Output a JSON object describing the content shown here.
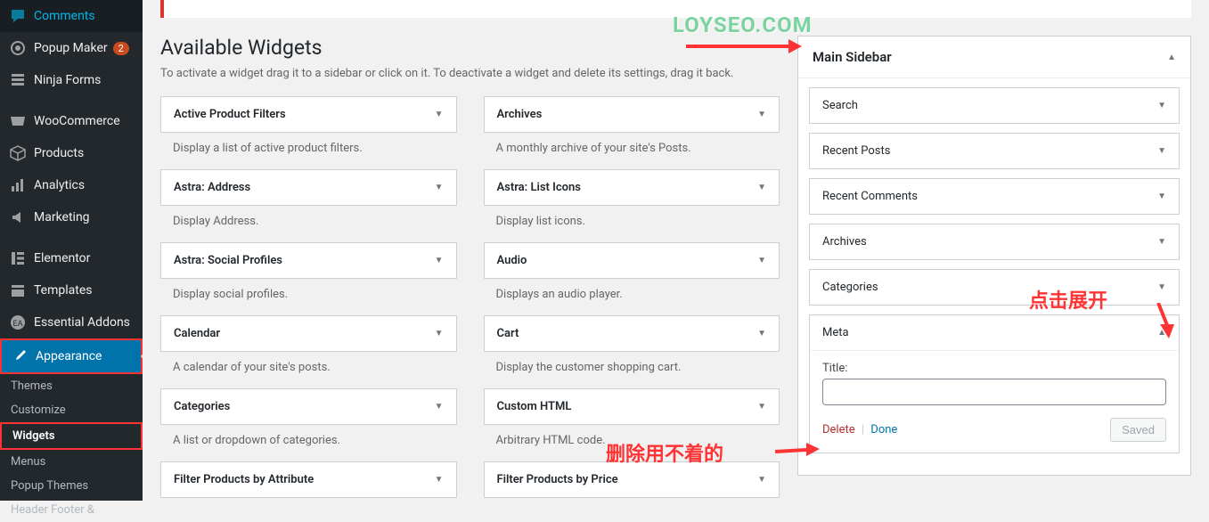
{
  "watermark": "LOYSEO.COM",
  "sidebar": {
    "items": [
      {
        "label": "Comments",
        "icon": "comment"
      },
      {
        "label": "Popup Maker",
        "icon": "popup",
        "badge": "2"
      },
      {
        "label": "Ninja Forms",
        "icon": "form"
      },
      {
        "label": "WooCommerce",
        "icon": "woo"
      },
      {
        "label": "Products",
        "icon": "product"
      },
      {
        "label": "Analytics",
        "icon": "analytics"
      },
      {
        "label": "Marketing",
        "icon": "marketing"
      },
      {
        "label": "Elementor",
        "icon": "elementor"
      },
      {
        "label": "Templates",
        "icon": "templates"
      },
      {
        "label": "Essential Addons",
        "icon": "addons"
      },
      {
        "label": "Appearance",
        "icon": "appearance",
        "active": true
      }
    ],
    "submenu": [
      {
        "label": "Themes"
      },
      {
        "label": "Customize"
      },
      {
        "label": "Widgets",
        "current": true
      },
      {
        "label": "Menus"
      },
      {
        "label": "Popup Themes"
      },
      {
        "label": "Header Footer &"
      }
    ]
  },
  "available": {
    "title": "Available Widgets",
    "desc": "To activate a widget drag it to a sidebar or click on it. To deactivate a widget and delete its settings, drag it back.",
    "widgets": [
      {
        "name": "Active Product Filters",
        "desc": "Display a list of active product filters."
      },
      {
        "name": "Archives",
        "desc": "A monthly archive of your site's Posts."
      },
      {
        "name": "Astra: Address",
        "desc": "Display Address."
      },
      {
        "name": "Astra: List Icons",
        "desc": "Display list icons."
      },
      {
        "name": "Astra: Social Profiles",
        "desc": "Display social profiles."
      },
      {
        "name": "Audio",
        "desc": "Displays an audio player."
      },
      {
        "name": "Calendar",
        "desc": "A calendar of your site's posts."
      },
      {
        "name": "Cart",
        "desc": "Display the customer shopping cart."
      },
      {
        "name": "Categories",
        "desc": "A list or dropdown of categories."
      },
      {
        "name": "Custom HTML",
        "desc": "Arbitrary HTML code."
      },
      {
        "name": "Filter Products by Attribute",
        "desc": ""
      },
      {
        "name": "Filter Products by Price",
        "desc": ""
      }
    ]
  },
  "main_sidebar": {
    "title": "Main Sidebar",
    "widgets": [
      {
        "name": "Search"
      },
      {
        "name": "Recent Posts"
      },
      {
        "name": "Recent Comments"
      },
      {
        "name": "Archives"
      },
      {
        "name": "Categories"
      }
    ],
    "meta": {
      "name": "Meta",
      "title_label": "Title:",
      "title_value": "",
      "delete": "Delete",
      "done": "Done",
      "saved": "Saved"
    }
  },
  "annotations": {
    "expand": "点击展开",
    "delete": "删除用不着的"
  }
}
